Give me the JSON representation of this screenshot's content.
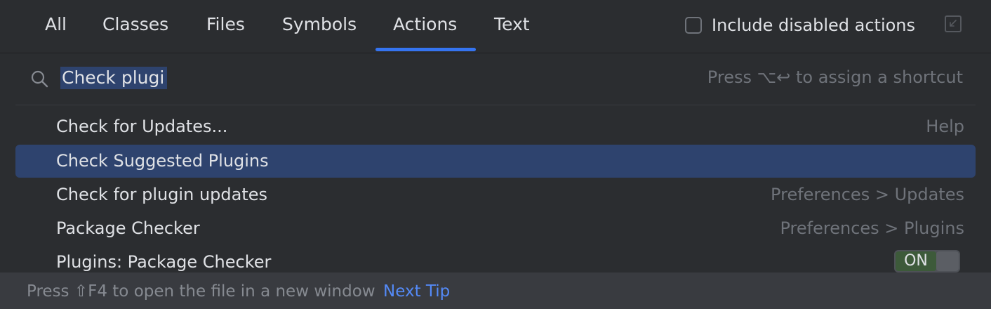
{
  "tabs": [
    {
      "label": "All"
    },
    {
      "label": "Classes"
    },
    {
      "label": "Files"
    },
    {
      "label": "Symbols"
    },
    {
      "label": "Actions",
      "selected": true
    },
    {
      "label": "Text"
    }
  ],
  "include_disabled": {
    "label": "Include disabled actions",
    "checked": false
  },
  "search": {
    "value": "Check plugi",
    "hint": "Press ⌥↩ to assign a shortcut"
  },
  "results": [
    {
      "label": "Check for Updates...",
      "meta": "Help"
    },
    {
      "label": "Check Suggested Plugins",
      "meta": "",
      "selected": true
    },
    {
      "label": "Check for plugin updates",
      "meta": "Preferences > Updates"
    },
    {
      "label": "Package Checker",
      "meta": "Preferences > Plugins"
    },
    {
      "label": "Plugins: Package Checker",
      "toggle": "ON"
    }
  ],
  "footer": {
    "tip": "Press ⇧F4 to open the file in a new window",
    "link": "Next Tip"
  },
  "colors": {
    "background": "#2b2d30",
    "selection": "#2e436e",
    "accent": "#3574f0",
    "link": "#548af7",
    "text": "#dfe1e5",
    "muted": "#6f737a"
  }
}
